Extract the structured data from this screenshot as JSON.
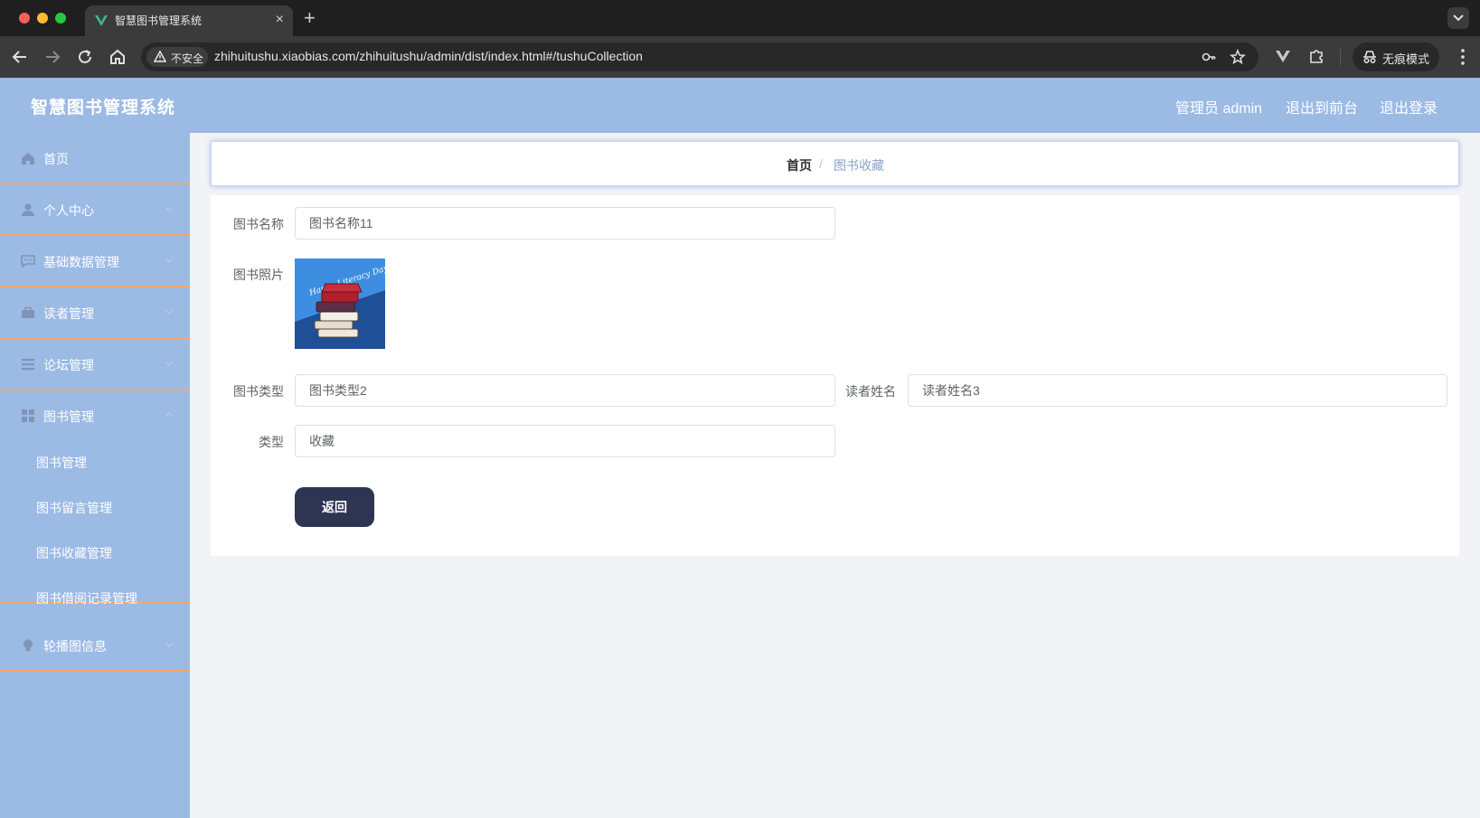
{
  "browser": {
    "tab_title": "智慧图书管理系统",
    "tab_close": "×",
    "new_tab": "+",
    "security_label": "不安全",
    "url": "zhihuitushu.xiaobias.com/zhihuitushu/admin/dist/index.html#/tushuCollection",
    "incognito_label": "无痕模式"
  },
  "header": {
    "title": "智慧图书管理系统",
    "user": "管理员 admin",
    "to_frontend": "退出到前台",
    "logout": "退出登录"
  },
  "sidebar": {
    "items": [
      {
        "label": "首页",
        "icon": "home-icon"
      },
      {
        "label": "个人中心",
        "icon": "user-icon"
      },
      {
        "label": "基础数据管理",
        "icon": "chat-icon"
      },
      {
        "label": "读者管理",
        "icon": "briefcase-icon"
      },
      {
        "label": "论坛管理",
        "icon": "list-icon"
      },
      {
        "label": "图书管理",
        "icon": "grid-icon"
      },
      {
        "label": "轮播图信息",
        "icon": "bulb-icon"
      }
    ],
    "book_submenu": [
      "图书管理",
      "图书留言管理",
      "图书收藏管理",
      "图书借阅记录管理"
    ]
  },
  "breadcrumb": {
    "home": "首页",
    "separator": "/",
    "current": "图书收藏"
  },
  "form": {
    "book_name_label": "图书名称",
    "book_name_value": "图书名称11",
    "book_photo_label": "图书照片",
    "book_type_label": "图书类型",
    "book_type_value": "图书类型2",
    "reader_name_label": "读者姓名",
    "reader_name_value": "读者姓名3",
    "type_label": "类型",
    "type_value": "收藏",
    "back_button": "返回"
  },
  "image": {
    "caption": "Happy Literacy Day!"
  },
  "colors": {
    "header_bg": "#9bbae4",
    "menu_divider": "#f0a86e",
    "button_bg": "#2e3553"
  }
}
